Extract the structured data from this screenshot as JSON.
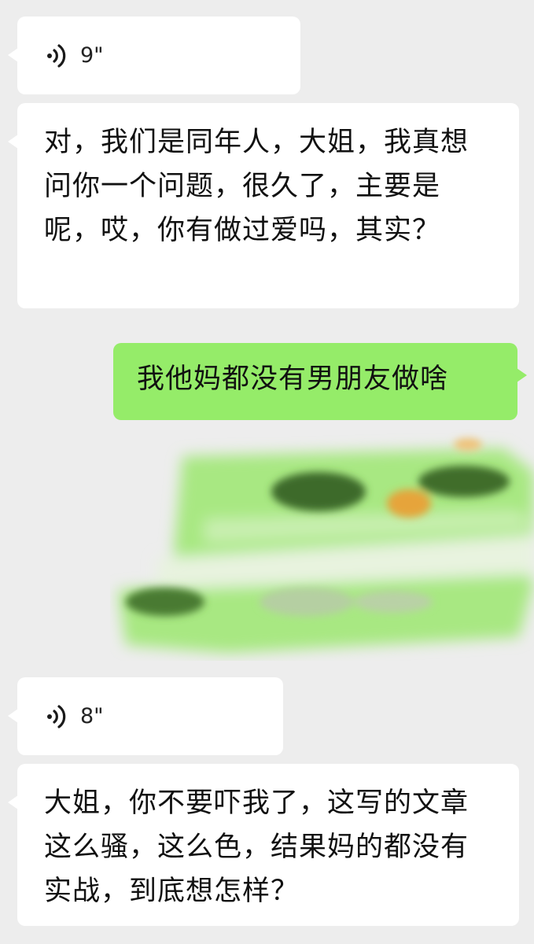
{
  "conversation": {
    "messages": [
      {
        "type": "voice",
        "direction": "incoming",
        "duration": "9\""
      },
      {
        "type": "text",
        "direction": "incoming",
        "text": "对，我们是同年人，大姐，我真想问你一个问题，很久了，主要是呢，哎，你有做过爱吗，其实？"
      },
      {
        "type": "text",
        "direction": "outgoing",
        "text": "我他妈都没有男朋友做啥"
      },
      {
        "type": "redacted",
        "direction": "outgoing",
        "note_color": "#95ec69"
      },
      {
        "type": "voice",
        "direction": "incoming",
        "duration": "8\""
      },
      {
        "type": "text",
        "direction": "incoming",
        "text": "大姐，你不要吓我了，这写的文章这么骚，这么色，结果妈的都没有实战，到底想怎样？"
      }
    ]
  },
  "icons": {
    "voice": "voice-wave-icon"
  },
  "colors": {
    "background": "#ededed",
    "incoming_bubble": "#ffffff",
    "outgoing_bubble": "#95ec69",
    "scribble_dark": "#3d6b2a",
    "scribble_orange": "#e6a43a"
  }
}
